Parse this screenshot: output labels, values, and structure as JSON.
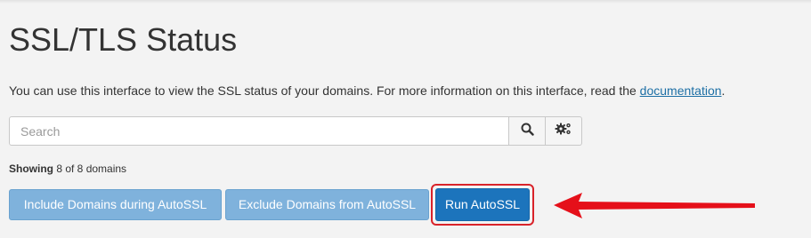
{
  "page": {
    "title": "SSL/TLS Status",
    "intro_text": "You can use this interface to view the SSL status of your domains. For more information on this interface, read the ",
    "intro_link": "documentation",
    "intro_end": "."
  },
  "search": {
    "placeholder": "Search",
    "value": "",
    "search_icon": "search-icon",
    "settings_icon": "gears-icon"
  },
  "status": {
    "showing_label": "Showing",
    "showing_text": " 8 of 8 domains"
  },
  "actions": {
    "include_label": "Include Domains during AutoSSL",
    "exclude_label": "Exclude Domains from AutoSSL",
    "run_label": "Run AutoSSL"
  },
  "annotation": {
    "highlight_color": "#d9232a",
    "arrow_icon": "left-arrow-icon"
  },
  "colors": {
    "button_light": "#7fb2dc",
    "button_primary": "#1c74bc",
    "link": "#1d6fa5",
    "background": "#f3f3f3"
  }
}
